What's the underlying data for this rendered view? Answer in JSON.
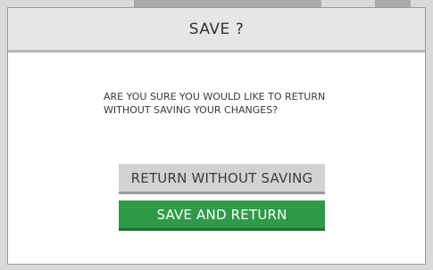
{
  "dialog": {
    "title": "SAVE ?",
    "message": "ARE YOU SURE YOU WOULD LIKE TO RETURN WITHOUT SAVING YOUR CHANGES?",
    "return_without_saving_label": "RETURN WITHOUT SAVING",
    "save_and_return_label": "SAVE AND RETURN"
  },
  "colors": {
    "primary_button": "#2e9a48",
    "secondary_button": "#d2d2d2",
    "header": "#e6e6e6"
  }
}
